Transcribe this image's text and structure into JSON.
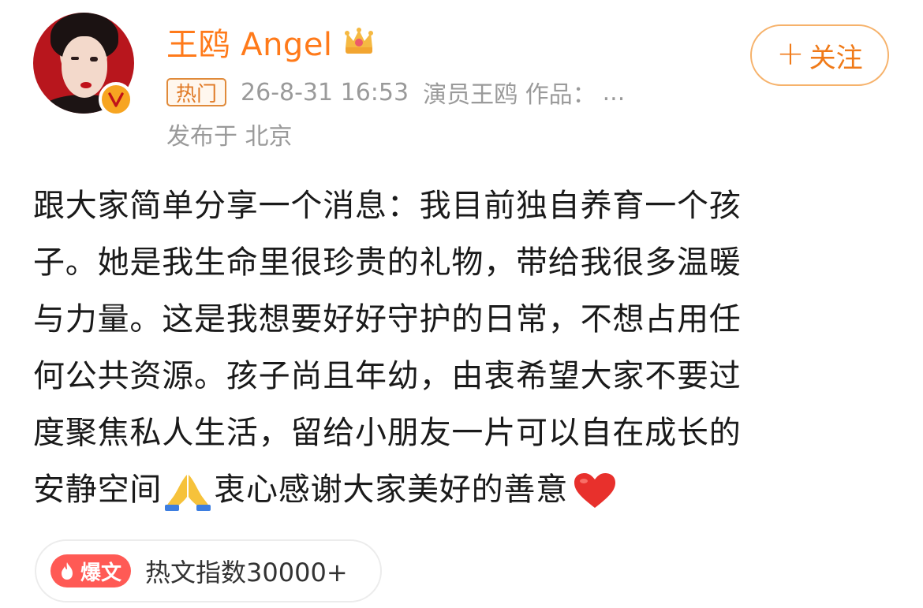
{
  "author": {
    "name": "王鸥 Angel",
    "verified_icon": "v-verified-icon",
    "badge_icon": "crown-icon"
  },
  "meta": {
    "tag": "热门",
    "timestamp": "26-8-31 16:53",
    "source": "演员王鸥 作品：",
    "source_more": "...",
    "location": "发布于 北京"
  },
  "follow_button": {
    "plus": "+",
    "label": "关注"
  },
  "post": {
    "lines": [
      "跟大家简单分享一个消息：我目前独自养育一个孩",
      "子。她是我生命里很珍贵的礼物，带给我很多温暖",
      "与力量。这是我想要好好守护的日常，不想占用任",
      "何公共资源。孩子尚且年幼，由衷希望大家不要过",
      "度聚焦私人生活，留给小朋友一片可以自在成长的"
    ],
    "last_line_a": "安静空间",
    "last_line_b": "衷心感谢大家美好的善意",
    "emoji_1": "pray-icon",
    "emoji_2": "heart-icon"
  },
  "hot_index": {
    "badge": "爆文",
    "text": "热文指数30000+"
  },
  "colors": {
    "accent": "#ff7a1a",
    "follow_border": "#f6b26b",
    "badge_red": "#ff5a55",
    "muted": "#9a9a9a"
  }
}
